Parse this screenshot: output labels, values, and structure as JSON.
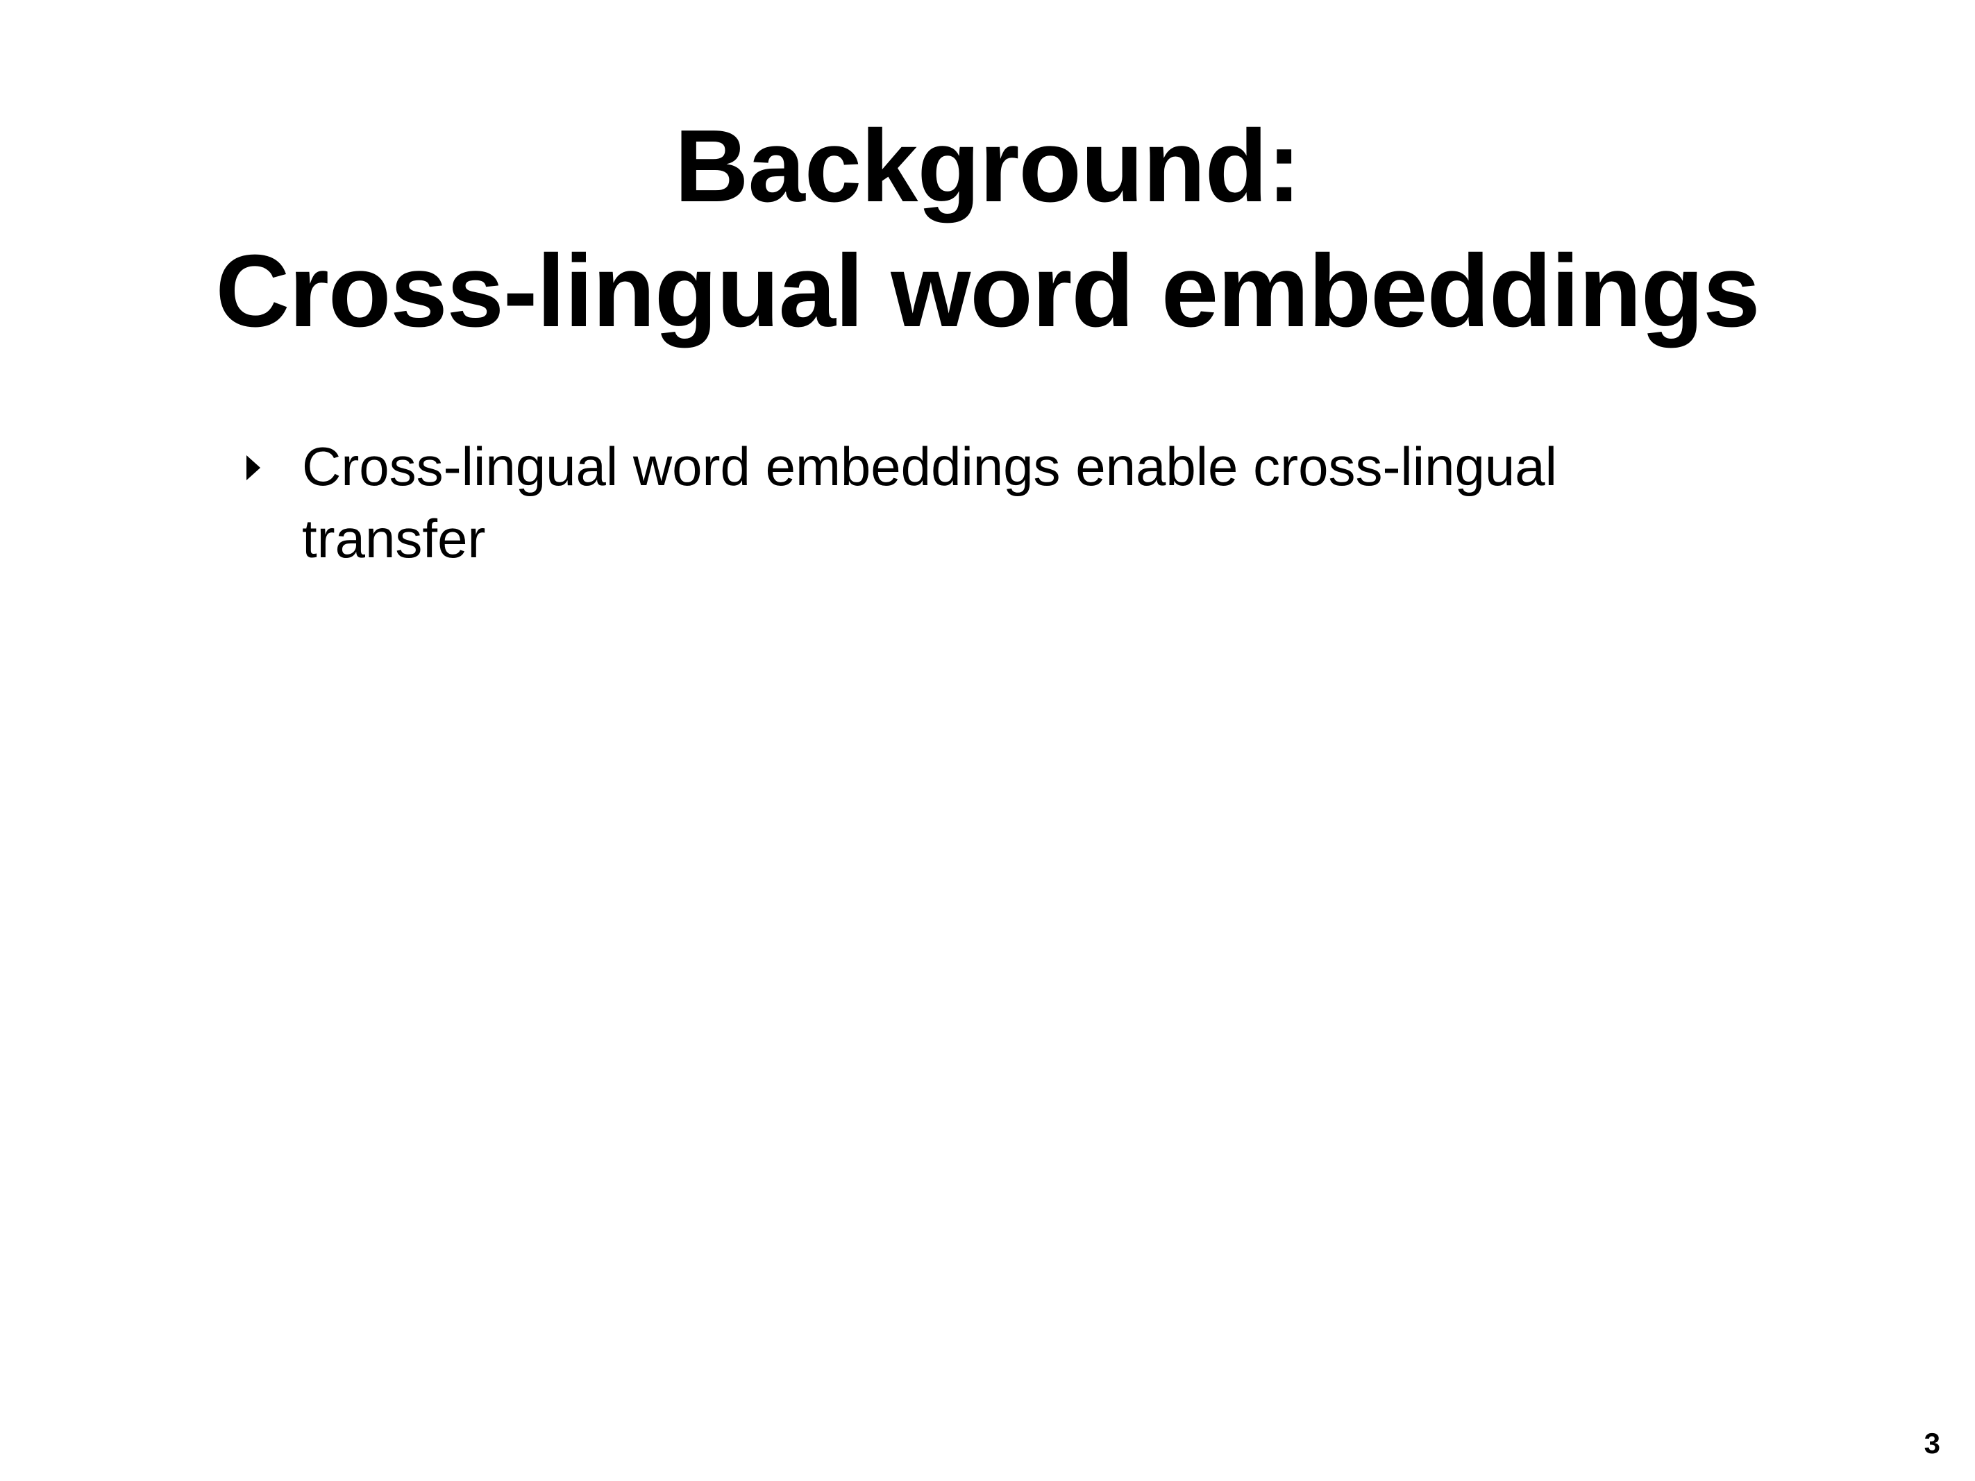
{
  "slide": {
    "title_line1": "Background:",
    "title_line2": "Cross-lingual word embeddings",
    "bullets": [
      {
        "text": "Cross-lingual word embeddings enable cross-lingual transfer",
        "marker_icon": "triangle-right-icon"
      }
    ],
    "page_number": "3"
  }
}
